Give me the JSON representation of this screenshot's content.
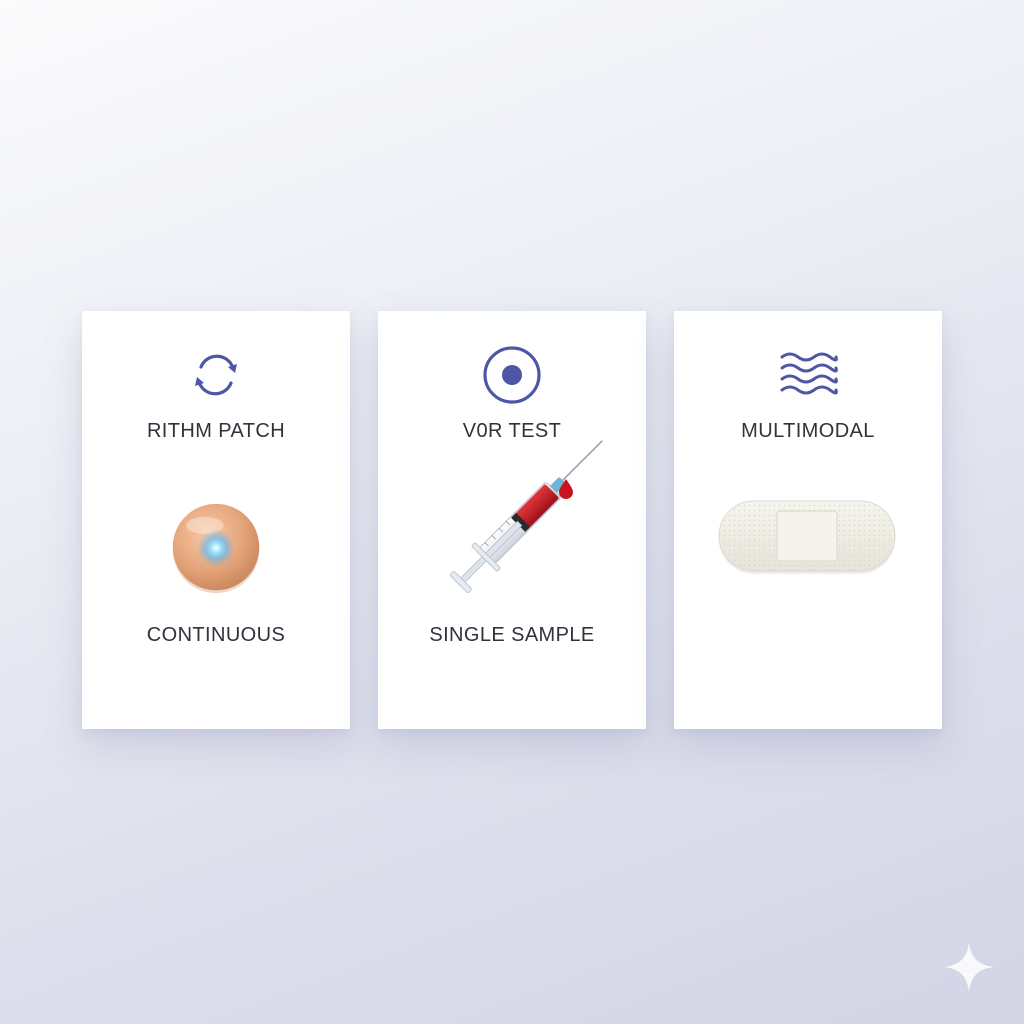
{
  "cards": [
    {
      "title": "RITHM PATCH",
      "caption": "CONTINUOUS",
      "icon": "sync-arrows-icon",
      "illustration": "skin-patch-sensor"
    },
    {
      "title": "V0R TEST",
      "caption": "SINGLE SAMPLE",
      "icon": "target-circle-icon",
      "illustration": "blood-syringe"
    },
    {
      "title": "MULTIMODAL",
      "caption": "",
      "icon": "waves-icon",
      "illustration": "adhesive-bandage"
    }
  ],
  "colors": {
    "icon_accent": "#4e56a6",
    "text": "#30323c",
    "card_background": "#ffffff",
    "page_background": "#e4e6f0"
  }
}
